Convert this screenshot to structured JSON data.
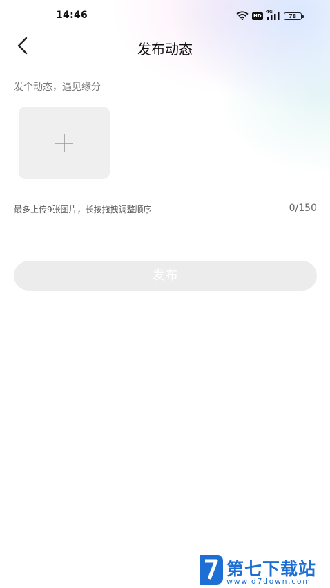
{
  "status_bar": {
    "time": "14:46",
    "hd_label": "HD",
    "network_label": "4G",
    "battery_level": "78",
    "icons": [
      "wifi-icon",
      "hd-icon",
      "signal-icon",
      "battery-icon"
    ]
  },
  "header": {
    "back_icon": "chevron-left-icon",
    "title": "发布动态"
  },
  "compose": {
    "prompt": "发个动态，遇见缘分",
    "add_photo_icon": "plus-icon",
    "upload_hint": "最多上传9张图片，长按拖拽调整顺序",
    "char_count": "0/150"
  },
  "actions": {
    "publish_label": "发布"
  },
  "watermark": {
    "site_name": "第七下载站",
    "url": "www.d7down.com"
  },
  "colors": {
    "button_disabled_bg": "#ececec",
    "tile_bg": "#efefef",
    "watermark_blue": "#1d6fd4"
  }
}
